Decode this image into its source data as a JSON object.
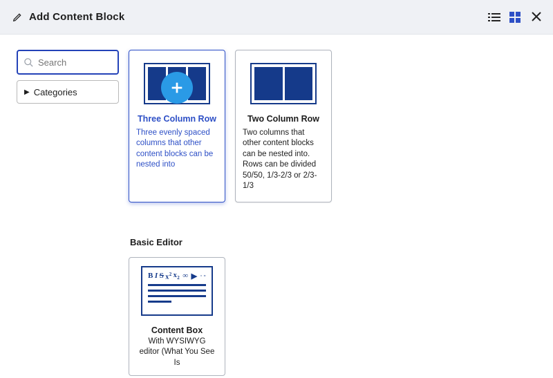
{
  "header": {
    "title": "Add Content Block"
  },
  "sidebar": {
    "search_placeholder": "Search",
    "categories_label": "Categories"
  },
  "sections": {
    "layout": {
      "cards": [
        {
          "title": "Three Column Row",
          "desc": "Three evenly spaced columns that other content blocks can be nested into"
        },
        {
          "title": "Two Column Row",
          "desc": "Two columns that other content blocks can be nested into. Rows can be divided 50/50, 1/3-2/3 or 2/3-1/3"
        }
      ]
    },
    "basic_editor": {
      "heading": "Basic Editor",
      "cards": [
        {
          "title": "Content Box",
          "desc": "With WYSIWYG editor (What You See Is"
        }
      ]
    }
  }
}
